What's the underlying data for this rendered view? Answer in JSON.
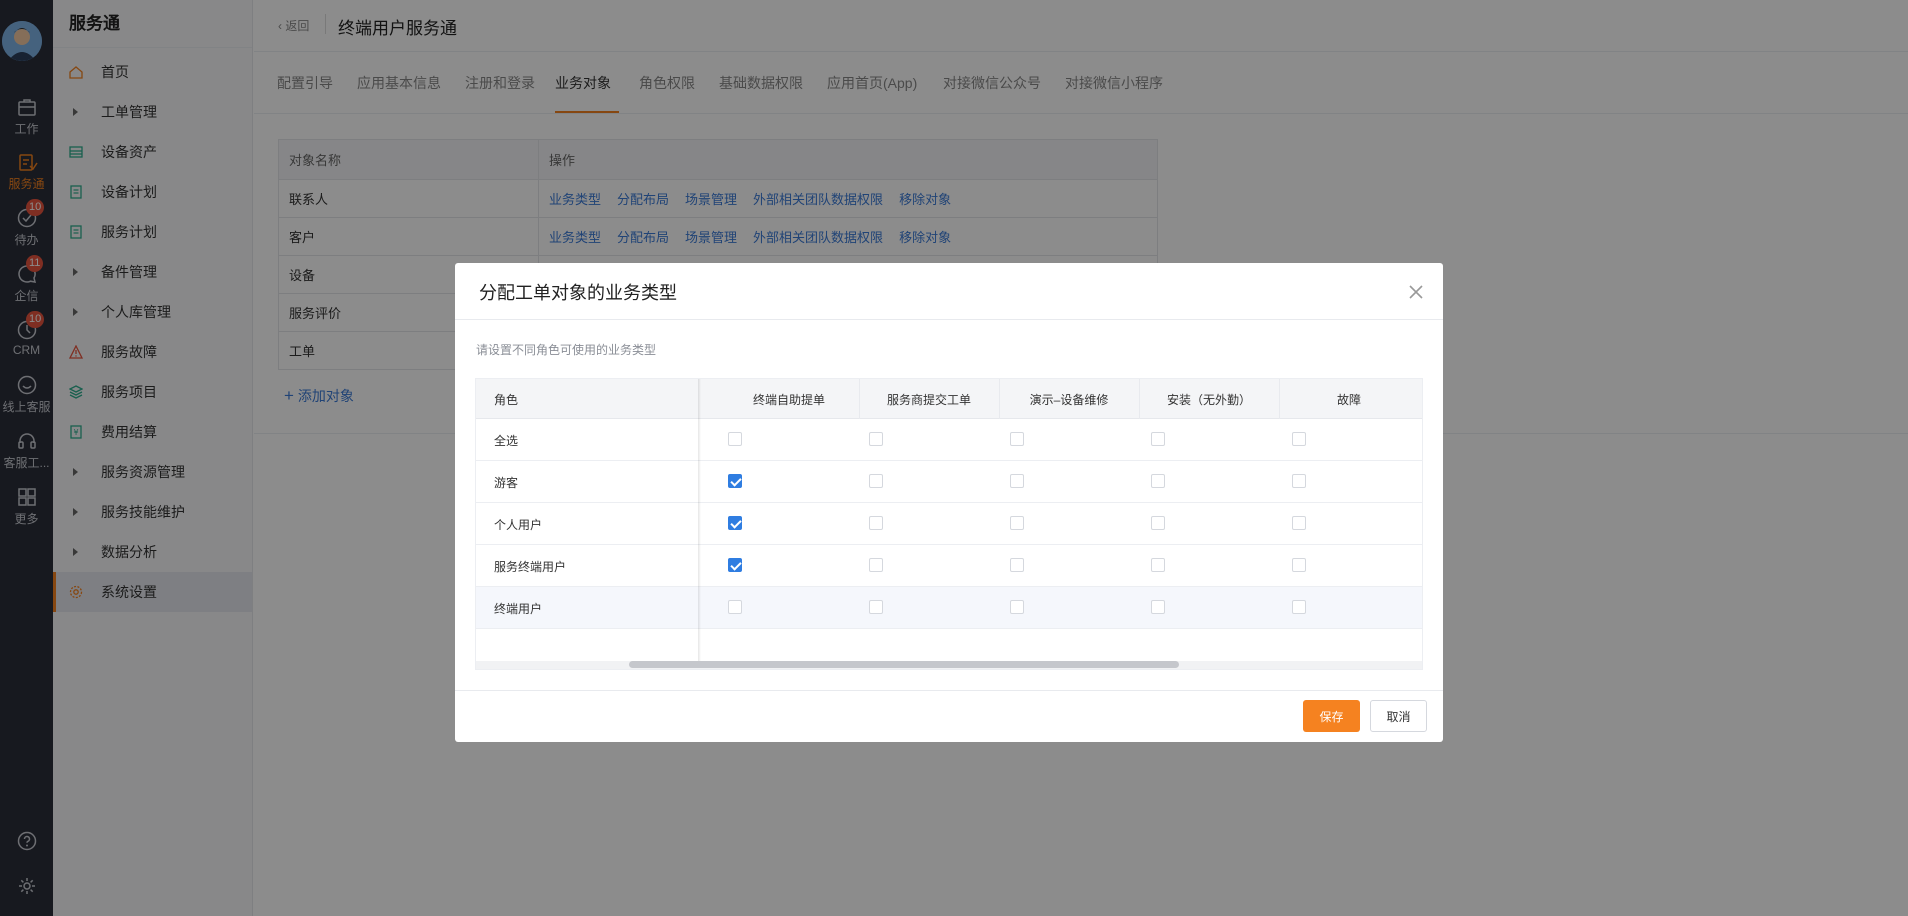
{
  "rail": {
    "items": [
      {
        "label": "工作",
        "icon": "briefcase-icon",
        "badge": ""
      },
      {
        "label": "服务通",
        "icon": "service-icon",
        "badge": "",
        "active": true
      },
      {
        "label": "待办",
        "icon": "check-circle-icon",
        "badge": "10"
      },
      {
        "label": "企信",
        "icon": "chat-icon",
        "badge": "11"
      },
      {
        "label": "CRM",
        "icon": "clock-icon",
        "badge": "10"
      },
      {
        "label": "线上客服",
        "icon": "smile-icon",
        "badge": ""
      },
      {
        "label": "客服工...",
        "icon": "headset-icon",
        "badge": ""
      },
      {
        "label": "更多",
        "icon": "grid-icon",
        "badge": ""
      }
    ]
  },
  "sidebar": {
    "title": "服务通",
    "items": [
      {
        "label": "首页",
        "icon": "home-icon"
      },
      {
        "label": "工单管理",
        "icon": "caret-right-icon"
      },
      {
        "label": "设备资产",
        "icon": "device-icon"
      },
      {
        "label": "设备计划",
        "icon": "doc-icon"
      },
      {
        "label": "服务计划",
        "icon": "doc-icon"
      },
      {
        "label": "备件管理",
        "icon": "caret-right-icon"
      },
      {
        "label": "个人库管理",
        "icon": "caret-right-icon"
      },
      {
        "label": "服务故障",
        "icon": "warning-icon"
      },
      {
        "label": "服务项目",
        "icon": "layers-icon"
      },
      {
        "label": "费用结算",
        "icon": "receipt-icon"
      },
      {
        "label": "服务资源管理",
        "icon": "caret-right-icon"
      },
      {
        "label": "服务技能维护",
        "icon": "caret-right-icon"
      },
      {
        "label": "数据分析",
        "icon": "caret-right-icon"
      },
      {
        "label": "系统设置",
        "icon": "gear-icon"
      }
    ]
  },
  "header": {
    "back": "返回",
    "title": "终端用户服务通"
  },
  "tabs": [
    "配置引导",
    "应用基本信息",
    "注册和登录",
    "业务对象",
    "角色权限",
    "基础数据权限",
    "应用首页(App)",
    "对接微信公众号",
    "对接微信小程序"
  ],
  "object_table": {
    "headers": [
      "对象名称",
      "操作"
    ],
    "rows": [
      {
        "name": "联系人",
        "ops": [
          "业务类型",
          "分配布局",
          "场景管理",
          "外部相关团队数据权限",
          "移除对象"
        ]
      },
      {
        "name": "客户",
        "ops": [
          "业务类型",
          "分配布局",
          "场景管理",
          "外部相关团队数据权限",
          "移除对象"
        ]
      },
      {
        "name": "设备",
        "ops": []
      },
      {
        "name": "服务评价",
        "ops": []
      },
      {
        "name": "工单",
        "ops": []
      }
    ],
    "add_label": "添加对象"
  },
  "modal": {
    "title": "分配工单对象的业务类型",
    "description": "请设置不同角色可使用的业务类型",
    "role_header": "角色",
    "columns": [
      "终端自助提单",
      "服务商提交工单",
      "演示–设备维修",
      "安装（无外勤）",
      "故障"
    ],
    "rows": [
      {
        "role": "全选",
        "checks": [
          false,
          false,
          false,
          false,
          false
        ]
      },
      {
        "role": "游客",
        "checks": [
          true,
          false,
          false,
          false,
          false
        ]
      },
      {
        "role": "个人用户",
        "checks": [
          true,
          false,
          false,
          false,
          false
        ]
      },
      {
        "role": "服务终端用户",
        "checks": [
          true,
          false,
          false,
          false,
          false
        ]
      },
      {
        "role": "终端用户",
        "checks": [
          false,
          false,
          false,
          false,
          false
        ]
      }
    ],
    "save_label": "保存",
    "cancel_label": "取消"
  },
  "colors": {
    "accent": "#f58220",
    "link": "#3b7bd8",
    "checkbox": "#2f7de1",
    "rail": "#2b2f3a",
    "badge": "#e8553f"
  }
}
